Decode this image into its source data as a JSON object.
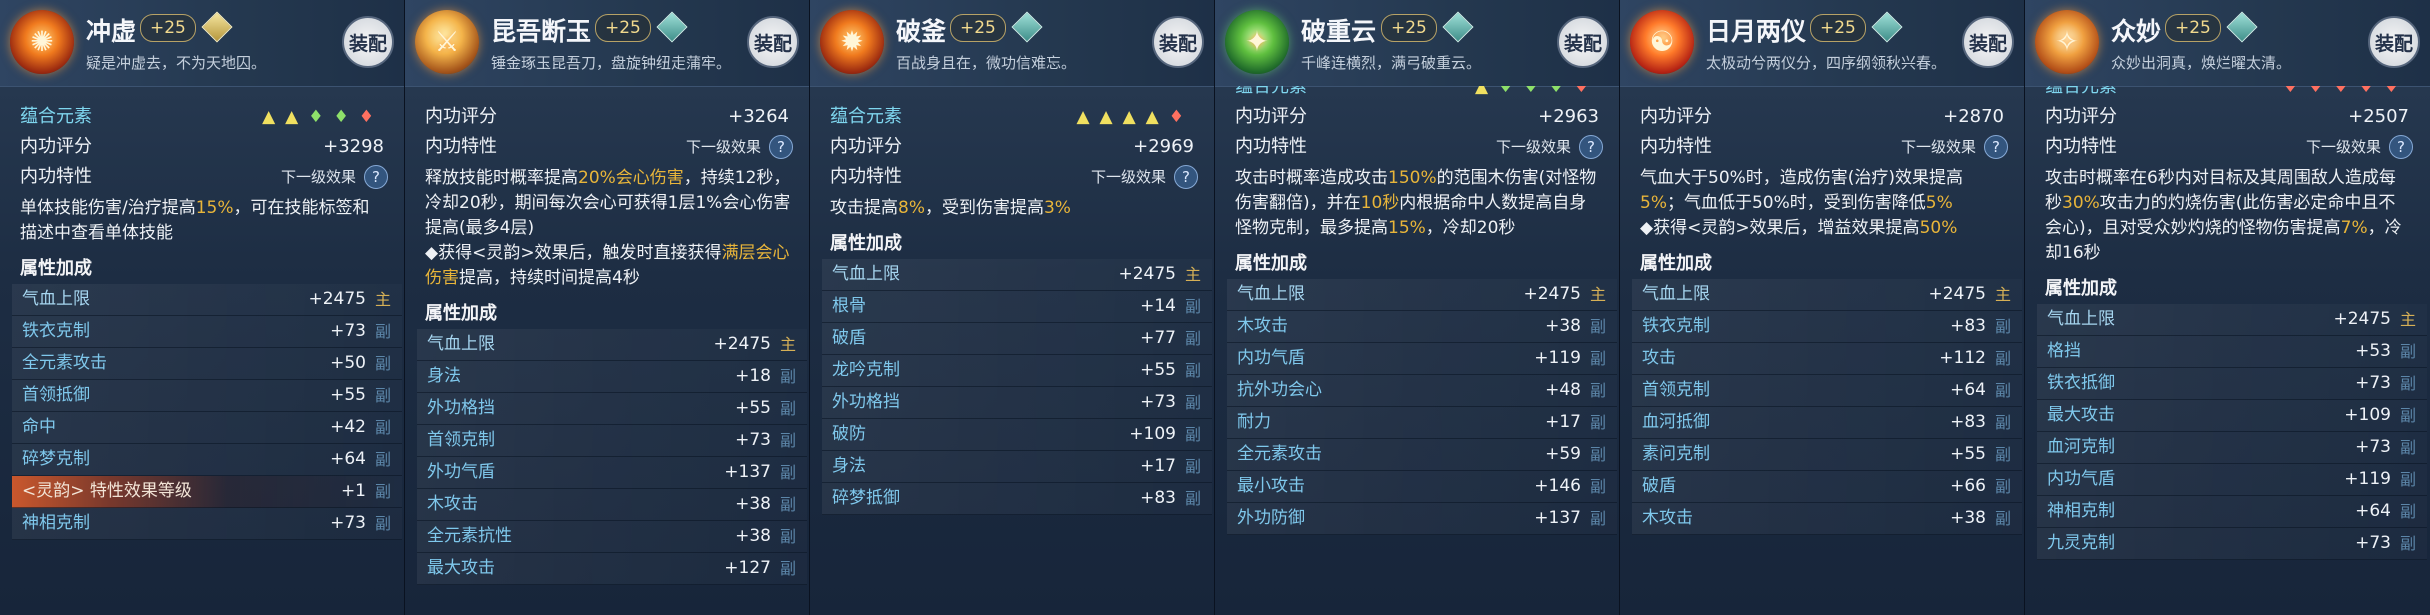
{
  "common": {
    "equip_label": "装配",
    "level": "+25",
    "score_label": "内功评分",
    "trait_label": "内功特性",
    "next_effect": "下一级效果",
    "element_label": "蕴合元素",
    "attr_section": "属性加成",
    "help_glyph": "?"
  },
  "cards": [
    {
      "name": "冲虚",
      "quote": "疑是冲虚去，不为天地囚。",
      "icon_glyph": "✺",
      "gem": "gold",
      "score": "+3298",
      "desc_parts": [
        "单体技能伤害/治疗提高",
        "15%",
        "，可在技能标签和描述中查看单体技能"
      ],
      "stats": [
        {
          "name": "气血上限",
          "value": "+2475",
          "tag": "主"
        },
        {
          "name": "铁衣克制",
          "value": "+73",
          "tag": "副"
        },
        {
          "name": "全元素攻击",
          "value": "+50",
          "tag": "副"
        },
        {
          "name": "首领抵御",
          "value": "+55",
          "tag": "副"
        },
        {
          "name": "命中",
          "value": "+42",
          "tag": "副"
        },
        {
          "name": "碎梦克制",
          "value": "+64",
          "tag": "副"
        },
        {
          "name": "<灵韵> 特性效果等级",
          "value": "+1",
          "tag": "副"
        },
        {
          "name": "神相克制",
          "value": "+73",
          "tag": "副"
        }
      ]
    },
    {
      "name": "昆吾断玉",
      "quote": "锤金琢玉昆吾刀，盘旋钟纽走蒲牢。",
      "icon_glyph": "⚔",
      "gem": "teal",
      "score": "+3264",
      "desc_parts": [
        "释放技能时概率提高",
        "20%会心伤害",
        "，持续12秒，冷却20秒，期间每次会心可获得1层1%会心伤害提高(最多4层)",
        "◆获得<灵韵>效果后，触发时直接获得",
        "满层会心伤害",
        "提高，持续时间提高4秒"
      ],
      "stats": [
        {
          "name": "气血上限",
          "value": "+2475",
          "tag": "主"
        },
        {
          "name": "身法",
          "value": "+18",
          "tag": "副"
        },
        {
          "name": "外功格挡",
          "value": "+55",
          "tag": "副"
        },
        {
          "name": "首领克制",
          "value": "+73",
          "tag": "副"
        },
        {
          "name": "外功气盾",
          "value": "+137",
          "tag": "副"
        },
        {
          "name": "木攻击",
          "value": "+38",
          "tag": "副"
        },
        {
          "name": "全元素抗性",
          "value": "+38",
          "tag": "副"
        },
        {
          "name": "最大攻击",
          "value": "+127",
          "tag": "副"
        }
      ]
    },
    {
      "name": "破釜",
      "quote": "百战身且在，微功信难忘。",
      "icon_glyph": "✹",
      "gem": "teal",
      "score": "+2969",
      "desc_parts": [
        "攻击提高",
        "8%",
        "，受到伤害提高",
        "3%"
      ],
      "stats": [
        {
          "name": "气血上限",
          "value": "+2475",
          "tag": "主"
        },
        {
          "name": "根骨",
          "value": "+14",
          "tag": "副"
        },
        {
          "name": "破盾",
          "value": "+77",
          "tag": "副"
        },
        {
          "name": "龙吟克制",
          "value": "+55",
          "tag": "副"
        },
        {
          "name": "外功格挡",
          "value": "+73",
          "tag": "副"
        },
        {
          "name": "破防",
          "value": "+109",
          "tag": "副"
        },
        {
          "name": "身法",
          "value": "+17",
          "tag": "副"
        },
        {
          "name": "碎梦抵御",
          "value": "+83",
          "tag": "副"
        }
      ]
    },
    {
      "name": "破重云",
      "quote": "千峰连横烈，满弓破重云。",
      "icon_glyph": "✦",
      "gem": "teal",
      "score": "+2963",
      "desc_parts": [
        "攻击时概率造成攻击",
        "150%",
        "的范围木伤害(对怪物伤害翻倍)，并在",
        "10秒",
        "内根据命中人数提高自身怪物克制，最多提高",
        "15%",
        "，冷却20秒"
      ],
      "stats": [
        {
          "name": "气血上限",
          "value": "+2475",
          "tag": "主"
        },
        {
          "name": "木攻击",
          "value": "+38",
          "tag": "副"
        },
        {
          "name": "内功气盾",
          "value": "+119",
          "tag": "副"
        },
        {
          "name": "抗外功会心",
          "value": "+48",
          "tag": "副"
        },
        {
          "name": "耐力",
          "value": "+17",
          "tag": "副"
        },
        {
          "name": "全元素攻击",
          "value": "+59",
          "tag": "副"
        },
        {
          "name": "最小攻击",
          "value": "+146",
          "tag": "副"
        },
        {
          "name": "外功防御",
          "value": "+137",
          "tag": "副"
        }
      ]
    },
    {
      "name": "日月两仪",
      "quote": "太极动兮两仪分，四序纲领秋兴春。",
      "icon_glyph": "☯",
      "gem": "teal",
      "score": "+2870",
      "desc_parts": [
        "气血大于50%时，造成伤害(治疗)效果提高",
        "5%",
        "；气血低于50%时，受到伤害降低",
        "5%",
        "◆获得<灵韵>效果后，增益效果提高",
        "50%"
      ],
      "stats": [
        {
          "name": "气血上限",
          "value": "+2475",
          "tag": "主"
        },
        {
          "name": "铁衣克制",
          "value": "+83",
          "tag": "副"
        },
        {
          "name": "攻击",
          "value": "+112",
          "tag": "副"
        },
        {
          "name": "首领克制",
          "value": "+64",
          "tag": "副"
        },
        {
          "name": "血河抵御",
          "value": "+83",
          "tag": "副"
        },
        {
          "name": "素问克制",
          "value": "+55",
          "tag": "副"
        },
        {
          "name": "破盾",
          "value": "+66",
          "tag": "副"
        },
        {
          "name": "木攻击",
          "value": "+38",
          "tag": "副"
        }
      ]
    },
    {
      "name": "众妙",
      "quote": "众妙出洞真，焕烂曜太清。",
      "icon_glyph": "✧",
      "gem": "teal",
      "score": "+2507",
      "desc_parts": [
        "攻击时概率在6秒内对目标及其周围敌人造成每秒",
        "30%",
        "攻击力的灼烧伤害(此伤害必定命中且不会心)，且对受众妙灼烧的怪物伤害提高",
        "7%",
        "，冷却16秒"
      ],
      "stats": [
        {
          "name": "气血上限",
          "value": "+2475",
          "tag": "主"
        },
        {
          "name": "格挡",
          "value": "+53",
          "tag": "副"
        },
        {
          "name": "铁衣抵御",
          "value": "+73",
          "tag": "副"
        },
        {
          "name": "最大攻击",
          "value": "+109",
          "tag": "副"
        },
        {
          "name": "血河克制",
          "value": "+73",
          "tag": "副"
        },
        {
          "name": "内功气盾",
          "value": "+119",
          "tag": "副"
        },
        {
          "name": "神相克制",
          "value": "+64",
          "tag": "副"
        },
        {
          "name": "九灵克制",
          "value": "+73",
          "tag": "副"
        }
      ]
    }
  ]
}
